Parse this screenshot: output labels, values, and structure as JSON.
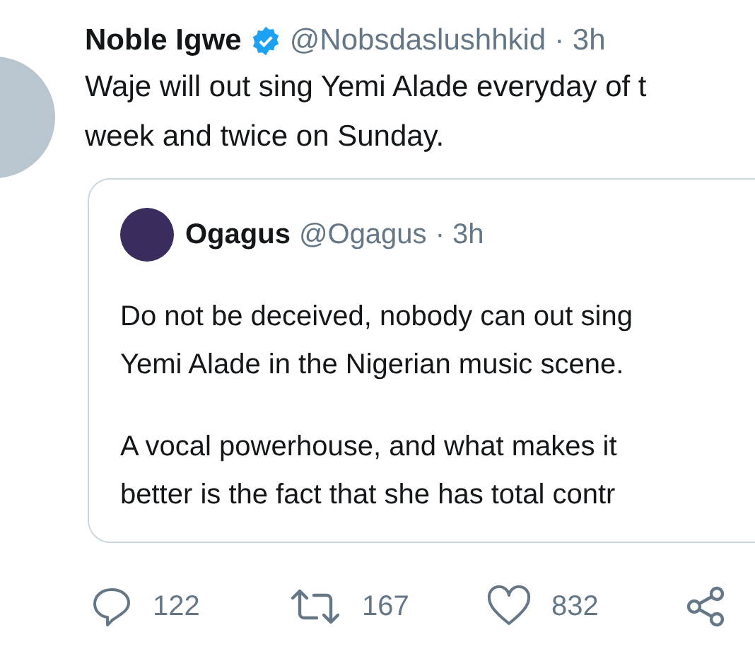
{
  "tweet": {
    "author": {
      "name": "Noble Igwe",
      "verified": true,
      "handle": "@Nobsdaslushhkid",
      "time": "· 3h"
    },
    "text_lines": [
      "Waje will out sing Yemi Alade everyday of t",
      "week and twice on Sunday."
    ],
    "quoted_tweet": {
      "author": {
        "name": "Ogagus",
        "handle": "@Ogagus",
        "time": "· 3h"
      },
      "paragraphs": [
        [
          "Do not be deceived, nobody can out sing",
          "Yemi Alade in the Nigerian music scene."
        ],
        [
          "A vocal powerhouse, and what makes it",
          "better is the fact that she has total contr"
        ]
      ]
    },
    "actions": [
      {
        "kind": "reply",
        "count": "122"
      },
      {
        "kind": "retweet",
        "count": "167"
      },
      {
        "kind": "like",
        "count": "832"
      },
      {
        "kind": "share"
      }
    ]
  }
}
